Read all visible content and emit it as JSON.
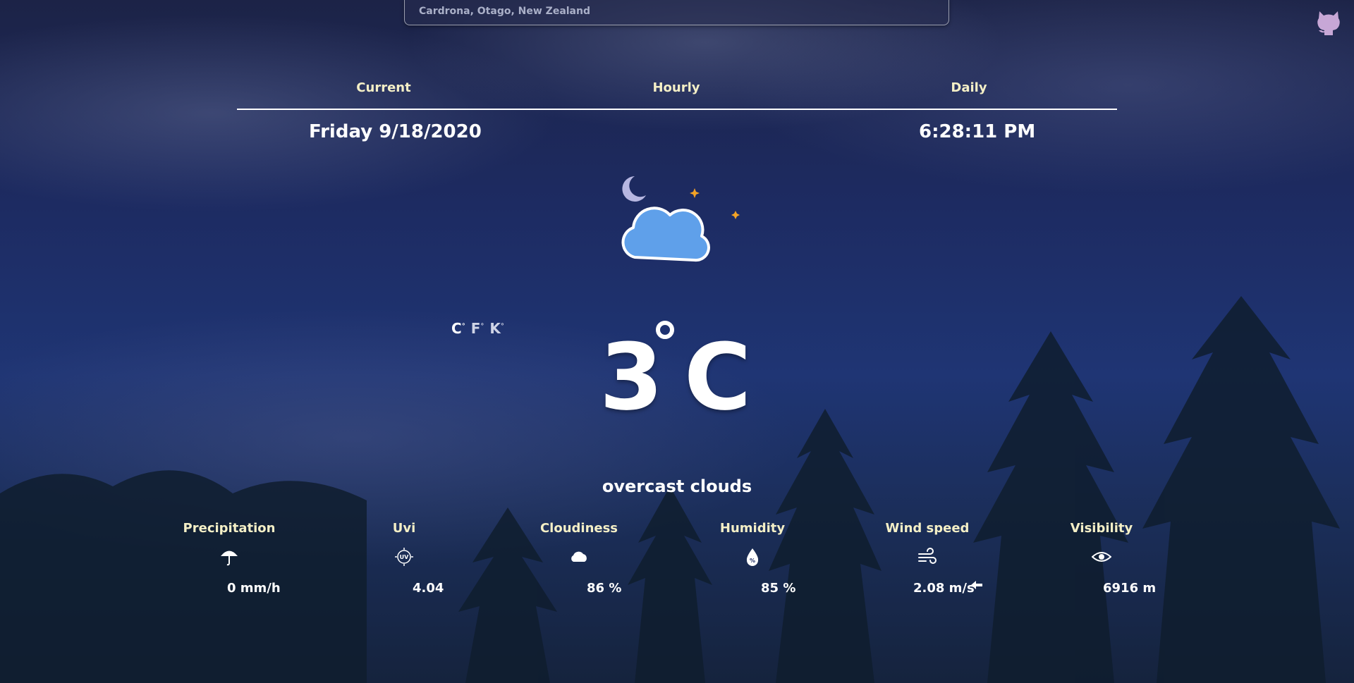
{
  "search": {
    "value": "Cardrona, Otago, New Zealand",
    "placeholder": "Cardrona, Otago, New Zealand"
  },
  "header": {
    "github_icon": "github-octocat-icon"
  },
  "tabs": [
    {
      "label": "Current"
    },
    {
      "label": "Hourly"
    },
    {
      "label": "Daily"
    }
  ],
  "current": {
    "date": "Friday 9/18/2020",
    "time": "6:28:11 PM",
    "weather_icon": "partly-cloudy-night-icon",
    "units": [
      {
        "label": "C",
        "active": true
      },
      {
        "label": "F",
        "active": false
      },
      {
        "label": "K",
        "active": false
      }
    ],
    "temperature": "3",
    "temperature_unit": "C",
    "description": "overcast clouds"
  },
  "stats": [
    {
      "label": "Precipitation",
      "value": "0 mm/h",
      "icon": "umbrella-icon"
    },
    {
      "label": "Uvi",
      "value": "4.04",
      "icon": "uv-icon"
    },
    {
      "label": "Cloudiness",
      "value": "86 %",
      "icon": "cloud-icon"
    },
    {
      "label": "Humidity",
      "value": "85 %",
      "icon": "humidity-drop-icon"
    },
    {
      "label": "Wind speed",
      "value": "2.08 m/s",
      "icon": "wind-icon",
      "extra_icon": "wind-direction-arrow-icon"
    },
    {
      "label": "Visibility",
      "value": "6916 m",
      "icon": "eye-icon"
    }
  ],
  "colors": {
    "accent_label": "#f4efc6",
    "cloud_blue": "#5fa0ea",
    "moon_orange": "#f3a326",
    "sky_dark": "#1d2b62"
  }
}
